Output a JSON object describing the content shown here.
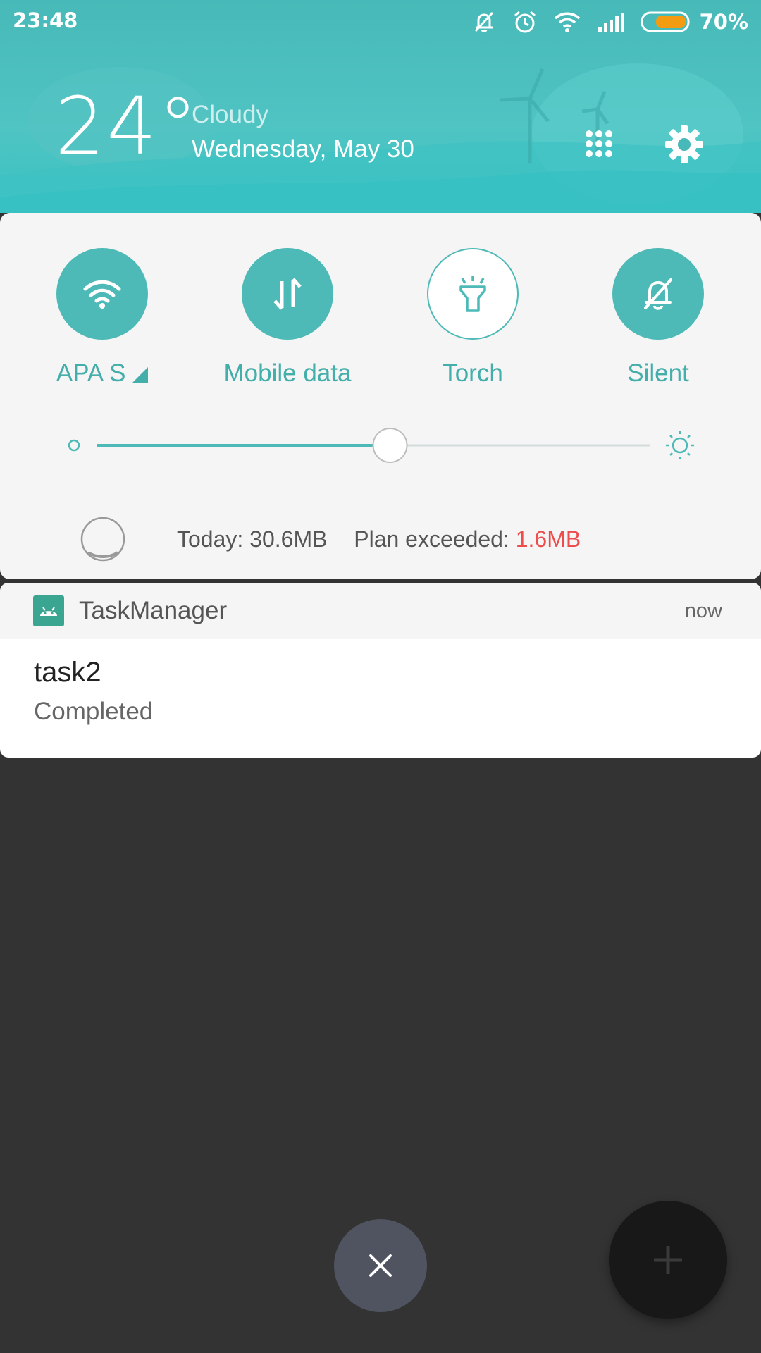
{
  "status_bar": {
    "time": "23:48",
    "battery_percent": "70%",
    "battery_level": 0.7,
    "icons": [
      "silent-bell-icon",
      "alarm-clock-icon",
      "wifi-icon",
      "signal-icon",
      "battery-icon"
    ]
  },
  "weather": {
    "temperature": "24°",
    "condition": "Cloudy",
    "date": "Wednesday, May 30"
  },
  "header_buttons": [
    "grid-menu-icon",
    "settings-gear-icon"
  ],
  "quick_toggles": [
    {
      "label": "APA S",
      "icon": "wifi-icon",
      "active": true
    },
    {
      "label": "Mobile data",
      "icon": "mobile-data-icon",
      "active": true
    },
    {
      "label": "Torch",
      "icon": "torch-icon",
      "active": false
    },
    {
      "label": "Silent",
      "icon": "silent-bell-icon",
      "active": true
    }
  ],
  "brightness": {
    "level": 0.53
  },
  "data_usage": {
    "today_label": "Today: 30.6MB",
    "plan_label": "Plan exceeded: ",
    "plan_value": "1.6MB",
    "over_color": "#ee4d4d"
  },
  "notification": {
    "app_name": "TaskManager",
    "time": "now",
    "title": "task2",
    "text": "Completed"
  },
  "colors": {
    "accent": "#4dbab7",
    "header": "#47b9b8",
    "background": "#333333"
  }
}
